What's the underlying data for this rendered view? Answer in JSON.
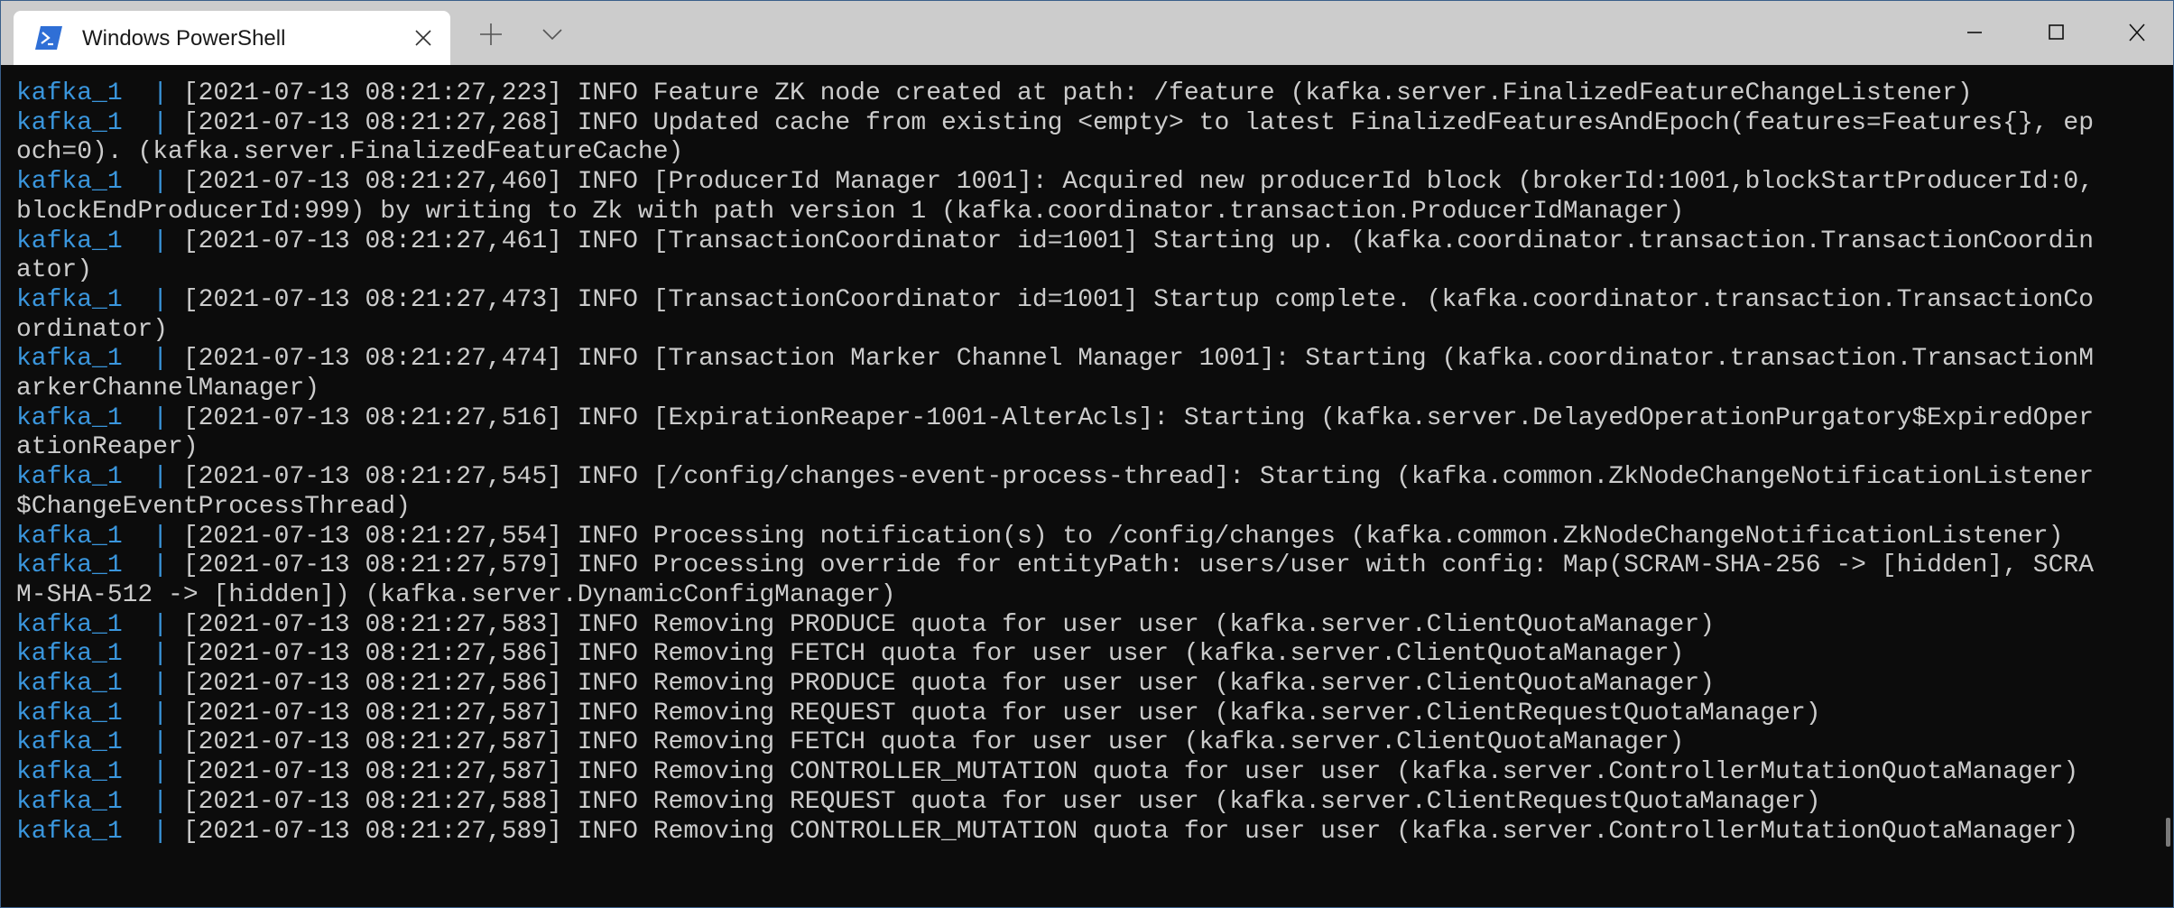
{
  "window": {
    "tab_title": "Windows PowerShell",
    "tab_icon": "powershell-icon",
    "colors": {
      "terminal_bg": "#0c0c0c",
      "text": "#cccccc",
      "service_prefix": "#3a96dd",
      "titlebar": "#cccccc",
      "icon_blue": "#2f6fd6"
    }
  },
  "log": [
    {
      "service": "kafka_1",
      "sep": "|",
      "text": "[2021-07-13 08:21:27,223] INFO Feature ZK node created at path: /feature (kafka.server.FinalizedFeatureChangeListener)"
    },
    {
      "service": "kafka_1",
      "sep": "|",
      "text": "[2021-07-13 08:21:27,268] INFO Updated cache from existing <empty> to latest FinalizedFeaturesAndEpoch(features=Features{}, epoch=0). (kafka.server.FinalizedFeatureCache)"
    },
    {
      "service": "kafka_1",
      "sep": "|",
      "text": "[2021-07-13 08:21:27,460] INFO [ProducerId Manager 1001]: Acquired new producerId block (brokerId:1001,blockStartProducerId:0,blockEndProducerId:999) by writing to Zk with path version 1 (kafka.coordinator.transaction.ProducerIdManager)"
    },
    {
      "service": "kafka_1",
      "sep": "|",
      "text": "[2021-07-13 08:21:27,461] INFO [TransactionCoordinator id=1001] Starting up. (kafka.coordinator.transaction.TransactionCoordinator)"
    },
    {
      "service": "kafka_1",
      "sep": "|",
      "text": "[2021-07-13 08:21:27,473] INFO [TransactionCoordinator id=1001] Startup complete. (kafka.coordinator.transaction.TransactionCoordinator)"
    },
    {
      "service": "kafka_1",
      "sep": "|",
      "text": "[2021-07-13 08:21:27,474] INFO [Transaction Marker Channel Manager 1001]: Starting (kafka.coordinator.transaction.TransactionMarkerChannelManager)"
    },
    {
      "service": "kafka_1",
      "sep": "|",
      "text": "[2021-07-13 08:21:27,516] INFO [ExpirationReaper-1001-AlterAcls]: Starting (kafka.server.DelayedOperationPurgatory$ExpiredOperationReaper)"
    },
    {
      "service": "kafka_1",
      "sep": "|",
      "text": "[2021-07-13 08:21:27,545] INFO [/config/changes-event-process-thread]: Starting (kafka.common.ZkNodeChangeNotificationListener$ChangeEventProcessThread)"
    },
    {
      "service": "kafka_1",
      "sep": "|",
      "text": "[2021-07-13 08:21:27,554] INFO Processing notification(s) to /config/changes (kafka.common.ZkNodeChangeNotificationListener)"
    },
    {
      "service": "kafka_1",
      "sep": "|",
      "text": "[2021-07-13 08:21:27,579] INFO Processing override for entityPath: users/user with config: Map(SCRAM-SHA-256 -> [hidden], SCRAM-SHA-512 -> [hidden]) (kafka.server.DynamicConfigManager)"
    },
    {
      "service": "kafka_1",
      "sep": "|",
      "text": "[2021-07-13 08:21:27,583] INFO Removing PRODUCE quota for user user (kafka.server.ClientQuotaManager)"
    },
    {
      "service": "kafka_1",
      "sep": "|",
      "text": "[2021-07-13 08:21:27,586] INFO Removing FETCH quota for user user (kafka.server.ClientQuotaManager)"
    },
    {
      "service": "kafka_1",
      "sep": "|",
      "text": "[2021-07-13 08:21:27,586] INFO Removing PRODUCE quota for user user (kafka.server.ClientQuotaManager)"
    },
    {
      "service": "kafka_1",
      "sep": "|",
      "text": "[2021-07-13 08:21:27,587] INFO Removing REQUEST quota for user user (kafka.server.ClientRequestQuotaManager)"
    },
    {
      "service": "kafka_1",
      "sep": "|",
      "text": "[2021-07-13 08:21:27,587] INFO Removing FETCH quota for user user (kafka.server.ClientQuotaManager)"
    },
    {
      "service": "kafka_1",
      "sep": "|",
      "text": "[2021-07-13 08:21:27,587] INFO Removing CONTROLLER_MUTATION quota for user user (kafka.server.ControllerMutationQuotaManager)"
    },
    {
      "service": "kafka_1",
      "sep": "|",
      "text": "[2021-07-13 08:21:27,588] INFO Removing REQUEST quota for user user (kafka.server.ClientRequestQuotaManager)"
    },
    {
      "service": "kafka_1",
      "sep": "|",
      "text": "[2021-07-13 08:21:27,589] INFO Removing CONTROLLER_MUTATION quota for user user (kafka.server.ControllerMutationQuotaManager)"
    }
  ]
}
